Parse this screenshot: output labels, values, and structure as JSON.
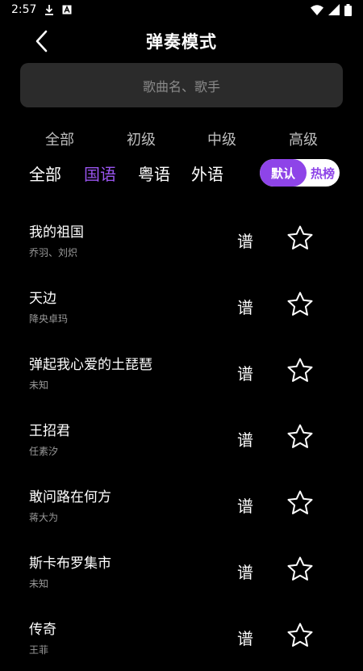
{
  "status_bar": {
    "time": "2:57",
    "icons": [
      "download-icon",
      "a-icon"
    ],
    "right_icons": [
      "wifi-icon",
      "signal-icon",
      "battery-icon"
    ]
  },
  "header": {
    "title": "弹奏模式",
    "back_icon": "chevron-left-icon"
  },
  "search": {
    "placeholder": "歌曲名、歌手"
  },
  "levels": [
    "全部",
    "初级",
    "中级",
    "高级"
  ],
  "languages": [
    {
      "label": "全部",
      "active": false
    },
    {
      "label": "国语",
      "active": true
    },
    {
      "label": "粤语",
      "active": false
    },
    {
      "label": "外语",
      "active": false
    }
  ],
  "sort_toggle": {
    "default": "默认",
    "hot": "热榜",
    "selected": "默认"
  },
  "songs": [
    {
      "title": "我的祖国",
      "artist": "乔羽、刘炽",
      "score_label": "谱",
      "favorited": false
    },
    {
      "title": "天边",
      "artist": "降央卓玛",
      "score_label": "谱",
      "favorited": false
    },
    {
      "title": "弹起我心爱的土琵琶",
      "artist": "未知",
      "score_label": "谱",
      "favorited": false
    },
    {
      "title": "王招君",
      "artist": "任素汐",
      "score_label": "谱",
      "favorited": false
    },
    {
      "title": "敢问路在何方",
      "artist": "蒋大为",
      "score_label": "谱",
      "favorited": false
    },
    {
      "title": "斯卡布罗集市",
      "artist": "未知",
      "score_label": "谱",
      "favorited": false
    },
    {
      "title": "传奇",
      "artist": "王菲",
      "score_label": "谱",
      "favorited": false
    }
  ],
  "colors": {
    "accent": "#8e44e8",
    "active_text": "#9a55f0",
    "background": "#000000",
    "search_bg": "#2b2b2b"
  }
}
